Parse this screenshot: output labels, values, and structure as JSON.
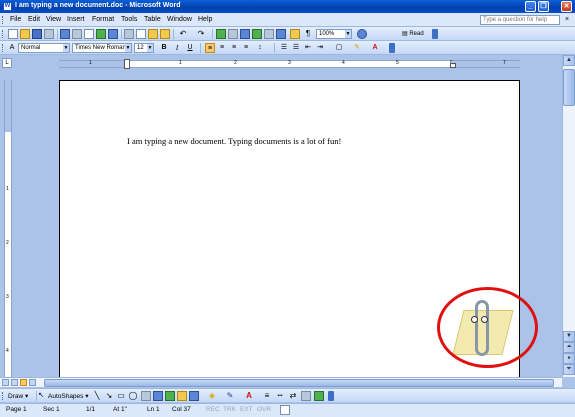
{
  "window": {
    "title": "I am typing a new document.doc - Microsoft Word",
    "app_icon_glyph": "W",
    "minimize_glyph": "_",
    "maximize_glyph": "❐",
    "close_glyph": "✕"
  },
  "menubar": {
    "items": [
      "File",
      "Edit",
      "View",
      "Insert",
      "Format",
      "Tools",
      "Table",
      "Window",
      "Help"
    ],
    "help_placeholder": "Type a question for help",
    "doc_close_glyph": "×"
  },
  "standard_toolbar": {
    "zoom": "100%",
    "read_label": "Read",
    "icons": [
      "new-doc-icon",
      "open-icon",
      "save-icon",
      "permission-icon",
      "email-icon",
      "print-icon",
      "print-preview-icon",
      "spelling-icon",
      "research-icon",
      "cut-icon",
      "copy-icon",
      "paste-icon",
      "format-painter-icon",
      "undo-icon",
      "redo-icon",
      "hyperlink-icon",
      "tables-borders-icon",
      "insert-table-icon",
      "insert-excel-icon",
      "columns-icon",
      "drawing-icon",
      "document-map-icon",
      "show-hide-icon",
      "help-icon"
    ]
  },
  "formatting_toolbar": {
    "style": "Normal",
    "font": "Times New Roman",
    "size": "12",
    "bold": "B",
    "italic": "I",
    "underline": "U",
    "show_hide": "¶"
  },
  "ruler": {
    "horizontal_numbers": [
      "1",
      "1",
      "2",
      "3",
      "4",
      "5",
      "6",
      "7"
    ],
    "vertical_numbers": [
      "1",
      "2",
      "3",
      "4"
    ],
    "tab_selector": "L"
  },
  "document": {
    "text": "I am typing a new document. Typing documents is a lot of fun!"
  },
  "drawing_toolbar": {
    "draw_label": "Draw",
    "autoshapes_label": "AutoShapes"
  },
  "statusbar": {
    "page": "Page  1",
    "section": "Sec  1",
    "pages": "1/1",
    "at": "At  1\"",
    "line": "Ln  1",
    "col": "Col  37",
    "rec": "REC",
    "trk": "TRK",
    "ext": "EXT",
    "ovr": "OVR"
  },
  "colors": {
    "title_bar": "#0a4fc7",
    "toolbar": "#c4d8f6",
    "assistant_circle": "#e01010"
  }
}
